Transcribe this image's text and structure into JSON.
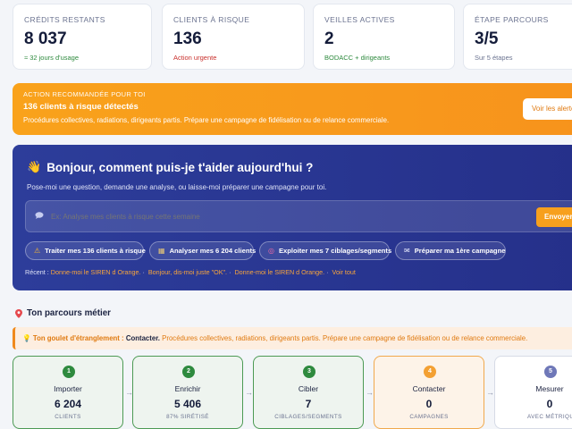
{
  "kpis": [
    {
      "label": "CRÉDITS RESTANTS",
      "value": "8 037",
      "sub": "≈ 32 jours d'usage"
    },
    {
      "label": "CLIENTS À RISQUE",
      "value": "136",
      "sub": "Action urgente"
    },
    {
      "label": "VEILLES ACTIVES",
      "value": "2",
      "sub": "BODACC + dirigeants"
    },
    {
      "label": "ÉTAPE PARCOURS",
      "value": "3/5",
      "sub": "Sur 5 étapes"
    }
  ],
  "banner": {
    "kicker": "ACTION RECOMMANDÉE POUR TOI",
    "title": "136 clients à risque détectés",
    "desc": "Procédures collectives, radiations, dirigeants partis. Prépare une campagne de fidélisation ou de relance commerciale.",
    "button": "Voir les alertes"
  },
  "assistant": {
    "wave": "👋",
    "greeting": "Bonjour, comment puis-je t'aider aujourd'hui ?",
    "subtitle": "Pose-moi une question, demande une analyse, ou laisse-moi préparer une campagne pour toi.",
    "placeholder": "Ex: Analyse mes clients à risque cette semaine",
    "send": "Envoyer",
    "chips": [
      {
        "icon": "⚠",
        "label": "Traiter mes 136 clients à risque"
      },
      {
        "icon": "▦",
        "label": "Analyser mes 6 204 clients"
      },
      {
        "icon": "◎",
        "label": "Exploiter mes 7 ciblages/segments"
      },
      {
        "icon": "✉",
        "label": "Préparer ma 1ère campagne"
      }
    ],
    "recent_label": "Récent :",
    "recent": [
      "Donne-moi le SIREN d Orange.",
      "Bonjour, dis-moi juste \"OK\".",
      "Donne-moi le SIREN d Orange.",
      "Voir tout"
    ]
  },
  "journey": {
    "title": "Ton parcours métier",
    "bottleneck_lead": "Ton goulet d'étranglement :",
    "bottleneck_step": "Contacter.",
    "bottleneck_rest": "Procédures collectives, radiations, dirigeants partis. Prépare une campagne de fidélisation ou de relance commerciale.",
    "steps": [
      {
        "num": "1",
        "name": "Importer",
        "value": "6 204",
        "sub": "CLIENTS"
      },
      {
        "num": "2",
        "name": "Enrichir",
        "value": "5 406",
        "sub": "87% SIRÉTISÉ"
      },
      {
        "num": "3",
        "name": "Cibler",
        "value": "7",
        "sub": "CIBLAGES/SEGMENTS"
      },
      {
        "num": "4",
        "name": "Contacter",
        "value": "0",
        "sub": "CAMPAGNES"
      },
      {
        "num": "5",
        "name": "Mesurer",
        "value": "0",
        "sub": "AVEC MÉTRIQUES"
      }
    ]
  },
  "colors": {
    "accent_orange": "#f7931c",
    "assistant_blue": "#2a3892",
    "done_green": "#2e8a3e"
  }
}
